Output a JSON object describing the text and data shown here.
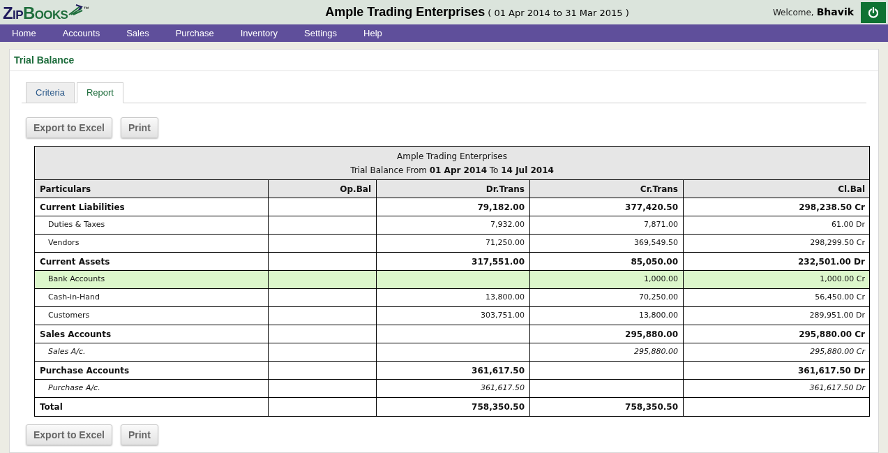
{
  "header": {
    "logo": "ZipBooks",
    "trademark": "™",
    "company": "Ample Trading Enterprises",
    "period": "( 01 Apr 2014 to 31 Mar 2015 )",
    "welcome": "Welcome,",
    "user": "Bhavik"
  },
  "nav": [
    "Home",
    "Accounts",
    "Sales",
    "Purchase",
    "Inventory",
    "Settings",
    "Help"
  ],
  "page_title": "Trial Balance",
  "tabs": [
    {
      "label": "Criteria",
      "selected": false
    },
    {
      "label": "Report",
      "selected": true
    }
  ],
  "top_buttons": [
    "Export to Excel",
    "Print"
  ],
  "bottom_buttons": [
    "Export to Excel",
    "Print"
  ],
  "report": {
    "title": "Ample Trading Enterprises",
    "subtitle": "Trial Balance From **01 Apr 2014** To **14 Jul 2014**",
    "columns": [
      "Particulars",
      "Op.Bal",
      "Dr.Trans",
      "Cr.Trans",
      "Cl.Bal"
    ],
    "rows": [
      {
        "kind": "group",
        "selected": false,
        "cells": [
          "Current Liabilities",
          "",
          "79,182.00",
          "377,420.50",
          "298,238.50 Cr"
        ]
      },
      {
        "kind": "item",
        "selected": false,
        "cells": [
          "Duties & Taxes",
          "",
          "7,932.00",
          "7,871.00",
          "61.00 Dr"
        ]
      },
      {
        "kind": "item",
        "selected": false,
        "cells": [
          "Vendors",
          "",
          "71,250.00",
          "369,549.50",
          "298,299.50 Cr"
        ]
      },
      {
        "kind": "group",
        "selected": false,
        "cells": [
          "Current Assets",
          "",
          "317,551.00",
          "85,050.00",
          "232,501.00 Dr"
        ]
      },
      {
        "kind": "item",
        "selected": true,
        "cells": [
          "Bank Accounts",
          "",
          "",
          "1,000.00",
          "1,000.00 Cr"
        ]
      },
      {
        "kind": "item",
        "selected": false,
        "cells": [
          "Cash-in-Hand",
          "",
          "13,800.00",
          "70,250.00",
          "56,450.00 Cr"
        ]
      },
      {
        "kind": "item",
        "selected": false,
        "cells": [
          "Customers",
          "",
          "303,751.00",
          "13,800.00",
          "289,951.00 Dr"
        ]
      },
      {
        "kind": "group",
        "selected": false,
        "cells": [
          "Sales Accounts",
          "",
          "",
          "295,880.00",
          "295,880.00 Cr"
        ]
      },
      {
        "kind": "ledger",
        "selected": false,
        "cells": [
          "Sales A/c.",
          "",
          "",
          "295,880.00",
          "295,880.00 Cr"
        ]
      },
      {
        "kind": "group",
        "selected": false,
        "cells": [
          "Purchase Accounts",
          "",
          "361,617.50",
          "",
          "361,617.50 Dr"
        ]
      },
      {
        "kind": "ledger",
        "selected": false,
        "cells": [
          "Purchase A/c.",
          "",
          "361,617.50",
          "",
          "361,617.50 Dr"
        ]
      },
      {
        "kind": "total",
        "selected": false,
        "cells": [
          "Total",
          "",
          "758,350.50",
          "758,350.50",
          ""
        ]
      }
    ]
  }
}
